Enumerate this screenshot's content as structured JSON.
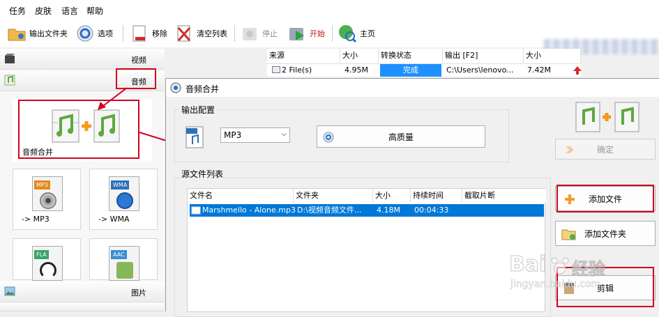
{
  "menu": [
    "任务",
    "皮肤",
    "语言",
    "帮助"
  ],
  "toolbar": {
    "output_folder": "输出文件夹",
    "options": "选项",
    "remove": "移除",
    "clear_list": "清空列表",
    "stop": "停止",
    "start": "开始",
    "home": "主页"
  },
  "left": {
    "video": "视频",
    "audio": "音频",
    "picture": "图片",
    "tiles": {
      "merge": "音频合并",
      "mp3": "-> MP3",
      "wma": "-> WMA"
    },
    "file_tags": [
      "MP3",
      "WMA",
      "FLA",
      "AAC"
    ]
  },
  "main_table": {
    "headers": [
      "来源",
      "大小",
      "转换状态",
      "输出 [F2]",
      "大小"
    ],
    "row": {
      "source": "2 File(s)",
      "size": "4.95M",
      "status": "完成",
      "output": "C:\\Users\\lenovo...",
      "out_size": "7.42M"
    }
  },
  "dialog": {
    "title": "音频合并",
    "output_config": "输出配置",
    "format": "MP3",
    "quality": "高质量",
    "source_list": "源文件列表",
    "confirm": "确定",
    "add_file": "添加文件",
    "add_folder": "添加文件夹",
    "clip": "剪辑",
    "table_headers": [
      "文件名",
      "文件夹",
      "大小",
      "持续时间",
      "截取片断"
    ],
    "file": {
      "name": "Marshmello - Alone.mp3",
      "folder": "D:\\视频音频文件...",
      "size": "4.18M",
      "duration": "00:04:33",
      "clip": ""
    }
  },
  "watermark": {
    "brand": "Bai",
    "brand2": "经验",
    "url": "jingyan.baidu.com"
  },
  "colors": {
    "highlight_red": "#d0021b",
    "status_blue": "#1e90ff",
    "selection_blue": "#0078d7",
    "note_green": "#5fa840",
    "plus_orange": "#f39a1e"
  }
}
